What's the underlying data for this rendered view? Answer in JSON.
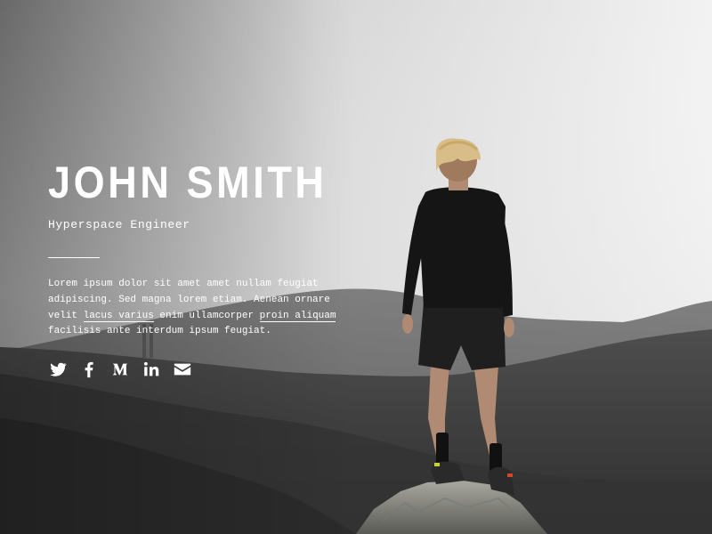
{
  "profile": {
    "name": "JOHN SMITH",
    "role": "Hyperspace Engineer",
    "bio": {
      "part1": "Lorem ipsum dolor sit amet amet nullam feugiat adipiscing. Sed magna lorem etiam. Aenean ornare velit ",
      "link1": "lacus varius",
      "part2": " enim ullamcorper ",
      "link2": "proin aliquam",
      "part3": " facilisis ante interdum ipsum feugiat."
    }
  },
  "social": [
    {
      "icon": "twitter-icon"
    },
    {
      "icon": "facebook-icon"
    },
    {
      "icon": "medium-icon"
    },
    {
      "icon": "linkedin-icon"
    },
    {
      "icon": "email-icon"
    }
  ],
  "colors": {
    "text": "#ffffff",
    "fog": "#f2f2f2",
    "hills": "#3c3c3c"
  }
}
